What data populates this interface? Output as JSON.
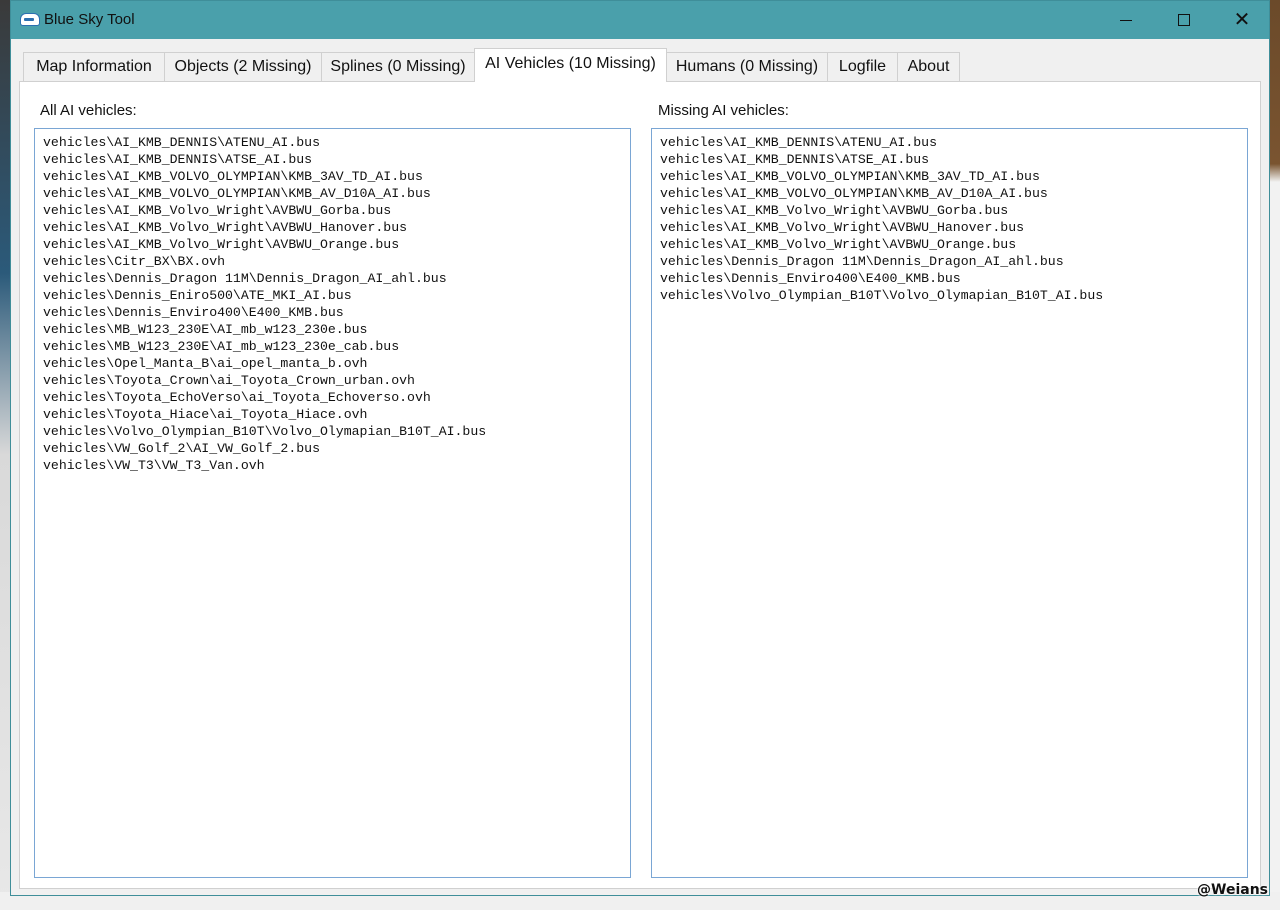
{
  "window": {
    "title": "Blue Sky Tool",
    "controls": {
      "minimize": "minimize",
      "maximize": "maximize",
      "close": "✕"
    }
  },
  "tabs": [
    {
      "label": "Map Information"
    },
    {
      "label": "Objects (2 Missing)"
    },
    {
      "label": "Splines (0 Missing)"
    },
    {
      "label": "AI Vehicles (10 Missing)",
      "active": true
    },
    {
      "label": "Humans (0 Missing)"
    },
    {
      "label": "Logfile"
    },
    {
      "label": "About"
    }
  ],
  "all_vehicles": {
    "label": "All AI vehicles:",
    "items": [
      "vehicles\\AI_KMB_DENNIS\\ATENU_AI.bus",
      "vehicles\\AI_KMB_DENNIS\\ATSE_AI.bus",
      "vehicles\\AI_KMB_VOLVO_OLYMPIAN\\KMB_3AV_TD_AI.bus",
      "vehicles\\AI_KMB_VOLVO_OLYMPIAN\\KMB_AV_D10A_AI.bus",
      "vehicles\\AI_KMB_Volvo_Wright\\AVBWU_Gorba.bus",
      "vehicles\\AI_KMB_Volvo_Wright\\AVBWU_Hanover.bus",
      "vehicles\\AI_KMB_Volvo_Wright\\AVBWU_Orange.bus",
      "vehicles\\Citr_BX\\BX.ovh",
      "vehicles\\Dennis_Dragon 11M\\Dennis_Dragon_AI_ahl.bus",
      "vehicles\\Dennis_Eniro500\\ATE_MKI_AI.bus",
      "vehicles\\Dennis_Enviro400\\E400_KMB.bus",
      "vehicles\\MB_W123_230E\\AI_mb_w123_230e.bus",
      "vehicles\\MB_W123_230E\\AI_mb_w123_230e_cab.bus",
      "vehicles\\Opel_Manta_B\\ai_opel_manta_b.ovh",
      "vehicles\\Toyota_Crown\\ai_Toyota_Crown_urban.ovh",
      "vehicles\\Toyota_EchoVerso\\ai_Toyota_Echoverso.ovh",
      "vehicles\\Toyota_Hiace\\ai_Toyota_Hiace.ovh",
      "vehicles\\Volvo_Olympian_B10T\\Volvo_Olymapian_B10T_AI.bus",
      "vehicles\\VW_Golf_2\\AI_VW_Golf_2.bus",
      "vehicles\\VW_T3\\VW_T3_Van.ovh"
    ]
  },
  "missing_vehicles": {
    "label": "Missing AI vehicles:",
    "items": [
      "vehicles\\AI_KMB_DENNIS\\ATENU_AI.bus",
      "vehicles\\AI_KMB_DENNIS\\ATSE_AI.bus",
      "vehicles\\AI_KMB_VOLVO_OLYMPIAN\\KMB_3AV_TD_AI.bus",
      "vehicles\\AI_KMB_VOLVO_OLYMPIAN\\KMB_AV_D10A_AI.bus",
      "vehicles\\AI_KMB_Volvo_Wright\\AVBWU_Gorba.bus",
      "vehicles\\AI_KMB_Volvo_Wright\\AVBWU_Hanover.bus",
      "vehicles\\AI_KMB_Volvo_Wright\\AVBWU_Orange.bus",
      "vehicles\\Dennis_Dragon 11M\\Dennis_Dragon_AI_ahl.bus",
      "vehicles\\Dennis_Enviro400\\E400_KMB.bus",
      "vehicles\\Volvo_Olympian_B10T\\Volvo_Olymapian_B10T_AI.bus"
    ]
  },
  "watermark": "@Weians",
  "colors": {
    "titlebar": "#4aa0ab",
    "listbox_border": "#7aa6d4"
  }
}
